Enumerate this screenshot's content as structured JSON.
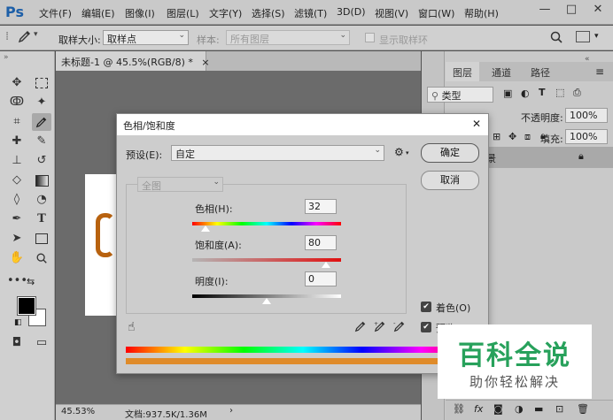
{
  "app": {
    "logo": "Ps"
  },
  "menu": [
    "文件(F)",
    "编辑(E)",
    "图像(I)",
    "图层(L)",
    "文字(Y)",
    "选择(S)",
    "滤镜(T)",
    "3D(D)",
    "视图(V)",
    "窗口(W)",
    "帮助(H)"
  ],
  "window_controls": {
    "minimize": "—",
    "maximize": "□",
    "close": "✕"
  },
  "options_bar": {
    "sample_size_label": "取样大小:",
    "sample_size_value": "取样点",
    "sample_label": "样本:",
    "sample_value": "所有图层",
    "show_ring_label": "显示取样环"
  },
  "document": {
    "tab_title": "未标题-1 @ 45.5%(RGB/8) *",
    "tab_close": "×",
    "zoom": "45.53%",
    "doc_info": "文档:937.5K/1.36M"
  },
  "layers_panel": {
    "tabs": [
      "图层",
      "通道",
      "路径"
    ],
    "filter_label": "类型",
    "opacity_label": "不透明度:",
    "opacity_value": "100%",
    "fill_label": "填充:",
    "fill_value": "100%",
    "layer_name": "景"
  },
  "dialog": {
    "title": "色相/饱和度",
    "close": "✕",
    "preset_label": "预设(E):",
    "preset_value": "自定",
    "channel_value": "全图",
    "ok_button": "确定",
    "cancel_button": "取消",
    "hue_label": "色相(H):",
    "hue_value": "32",
    "saturation_label": "饱和度(A):",
    "saturation_value": "80",
    "lightness_label": "明度(I):",
    "lightness_value": "0",
    "colorize_label": "着色(O)",
    "colorize_checked": true,
    "preview_label": "预览(P)",
    "hue_fraction": 0.09,
    "saturation_fraction": 0.9,
    "lightness_fraction": 0.5
  },
  "watermark": {
    "title": "百科全说",
    "subtitle": "助你轻松解决",
    "color": "#27a15b"
  }
}
